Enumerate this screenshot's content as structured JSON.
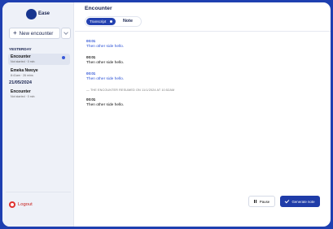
{
  "app": {
    "logo_text": "Ease"
  },
  "sidebar": {
    "new_encounter_label": "New encounter",
    "sections": [
      {
        "label": "YESTERDAY",
        "items": [
          {
            "title": "Encounter",
            "sub": "Not started · 0 min",
            "active": true,
            "unread": true
          },
          {
            "title": "Emeka Nwoye",
            "sub": "8:41am · 26 mins",
            "active": false,
            "unread": false
          }
        ]
      },
      {
        "label": "21/05/2024",
        "items": [
          {
            "title": "Encounter",
            "sub": "Not started · 0 min",
            "active": false,
            "unread": false
          }
        ]
      }
    ],
    "logout_label": "Logout"
  },
  "main": {
    "title": "Encounter",
    "tabs": {
      "transcript": "Transcript",
      "note": "Note"
    },
    "entries": [
      {
        "time": "00:01",
        "text": "Then other side hello.",
        "speaker": "blue"
      },
      {
        "time": "00:01",
        "text": "Then other side hello.",
        "speaker": "black"
      },
      {
        "time": "00:01",
        "text": "Then other side hello.",
        "speaker": "blue"
      }
    ],
    "resumed_text": "— THE ENCOUNTER RESUMED ON 11/1/2024 AT 10:52AM",
    "entries_after": [
      {
        "time": "00:01",
        "text": "Then other side hello.",
        "speaker": "black"
      }
    ],
    "pause_label": "Pause",
    "generate_label": "Generate note"
  },
  "colors": {
    "frame": "#1e3fb0",
    "accent": "#2341b0",
    "speaker_blue": "#2d53d6",
    "logout_red": "#e0312e"
  }
}
